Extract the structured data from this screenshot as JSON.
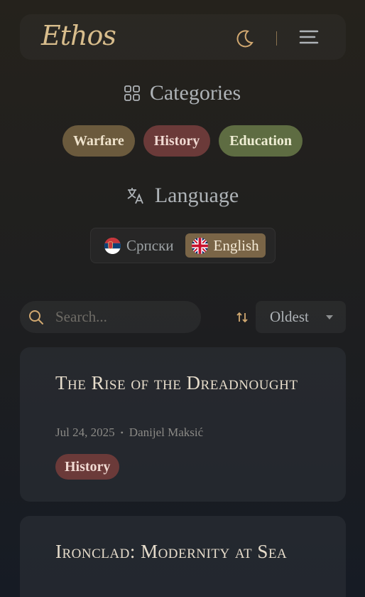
{
  "header": {
    "logo": "Ethos",
    "theme_icon": "moon-icon",
    "menu_icon": "hamburger-menu-icon"
  },
  "categories": {
    "title": "Categories",
    "icon": "grid-icon",
    "items": [
      {
        "label": "Warfare",
        "color": "#6b5a3d"
      },
      {
        "label": "History",
        "color": "#6b3a39"
      },
      {
        "label": "Education",
        "color": "#5e6c42"
      }
    ]
  },
  "language": {
    "title": "Language",
    "icon": "translate-icon",
    "options": [
      {
        "label": "Српски",
        "flag": "serbia-flag-icon",
        "selected": false
      },
      {
        "label": "English",
        "flag": "uk-flag-icon",
        "selected": true
      }
    ]
  },
  "search": {
    "placeholder": "Search...",
    "value": ""
  },
  "sort": {
    "icon": "sort-arrows-icon",
    "selected": "Oldest"
  },
  "articles": [
    {
      "title": "The Rise of the Dreadnought",
      "date": "Jul 24, 2025",
      "author": "Danijel Maksić",
      "tag": "History"
    },
    {
      "title": "Ironclad: Modernity at Sea"
    }
  ]
}
